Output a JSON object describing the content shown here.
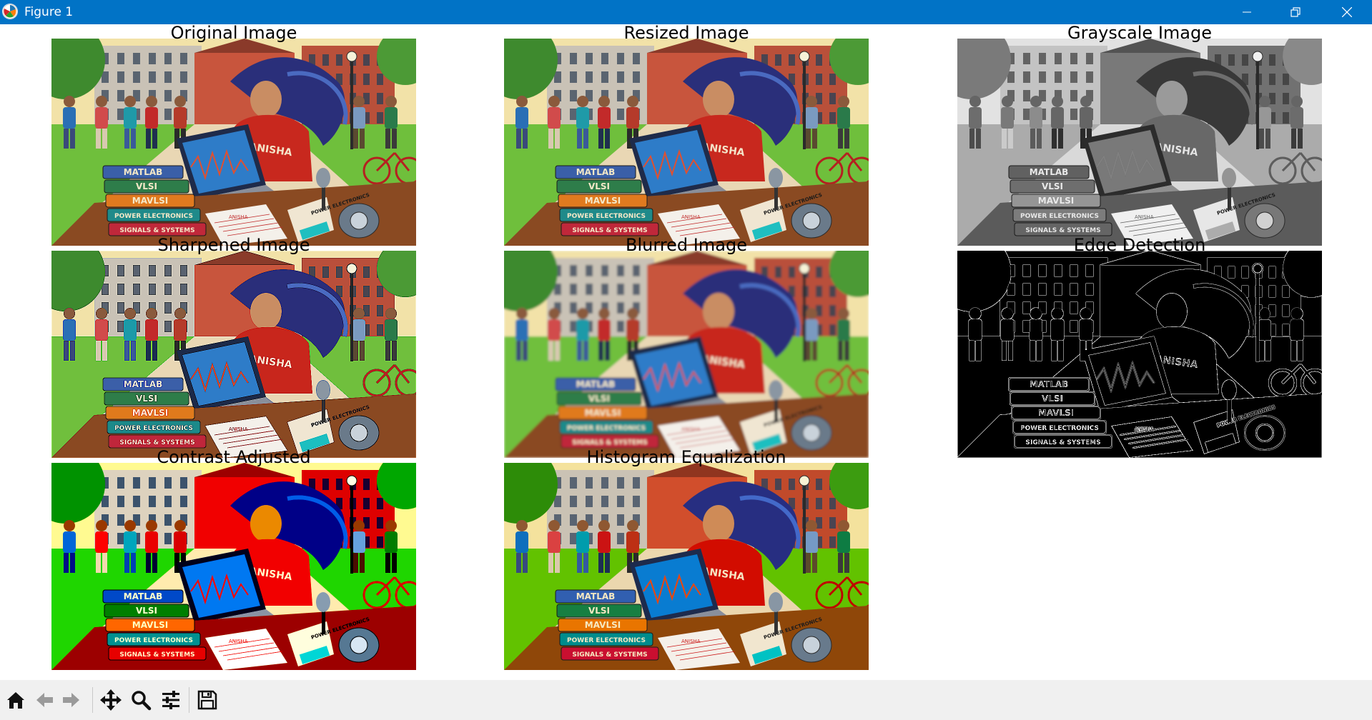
{
  "window": {
    "title": "Figure 1",
    "titlebar_color": "#0173c6",
    "icons": {
      "app": "matplotlib-logo-icon",
      "minimize": "minimize-icon",
      "restore": "restore-icon",
      "close": "close-icon"
    }
  },
  "figure": {
    "panels": [
      {
        "title": "Original Image",
        "variant": "color"
      },
      {
        "title": "Resized Image",
        "variant": "color"
      },
      {
        "title": "Grayscale Image",
        "variant": "grayscale"
      },
      {
        "title": "Sharpened Image",
        "variant": "sharpened"
      },
      {
        "title": "Blurred Image",
        "variant": "blurred"
      },
      {
        "title": "Edge Detection",
        "variant": "edges"
      },
      {
        "title": "Contrast Adjusted",
        "variant": "contrast"
      },
      {
        "title": "Histogram Equalization",
        "variant": "equalized"
      }
    ],
    "artwork": {
      "shirt_text": "ANISHA",
      "books": [
        "MATLAB",
        "VLSI",
        "MAVLSI",
        "POWER ELECTRONICS",
        "SIGNALS & SYSTEMS"
      ],
      "notebook_text": "POWER ELECTRONICS",
      "paper_text": "ANISHA"
    }
  },
  "toolbar": {
    "buttons": [
      {
        "name": "home-button",
        "icon": "home-icon"
      },
      {
        "name": "back-button",
        "icon": "arrow-left-icon"
      },
      {
        "name": "forward-button",
        "icon": "arrow-right-icon"
      },
      {
        "name": "pan-button",
        "icon": "move-icon"
      },
      {
        "name": "zoom-button",
        "icon": "magnifier-icon"
      },
      {
        "name": "configure-subplots-button",
        "icon": "sliders-icon"
      },
      {
        "name": "save-button",
        "icon": "floppy-disk-icon"
      }
    ]
  }
}
